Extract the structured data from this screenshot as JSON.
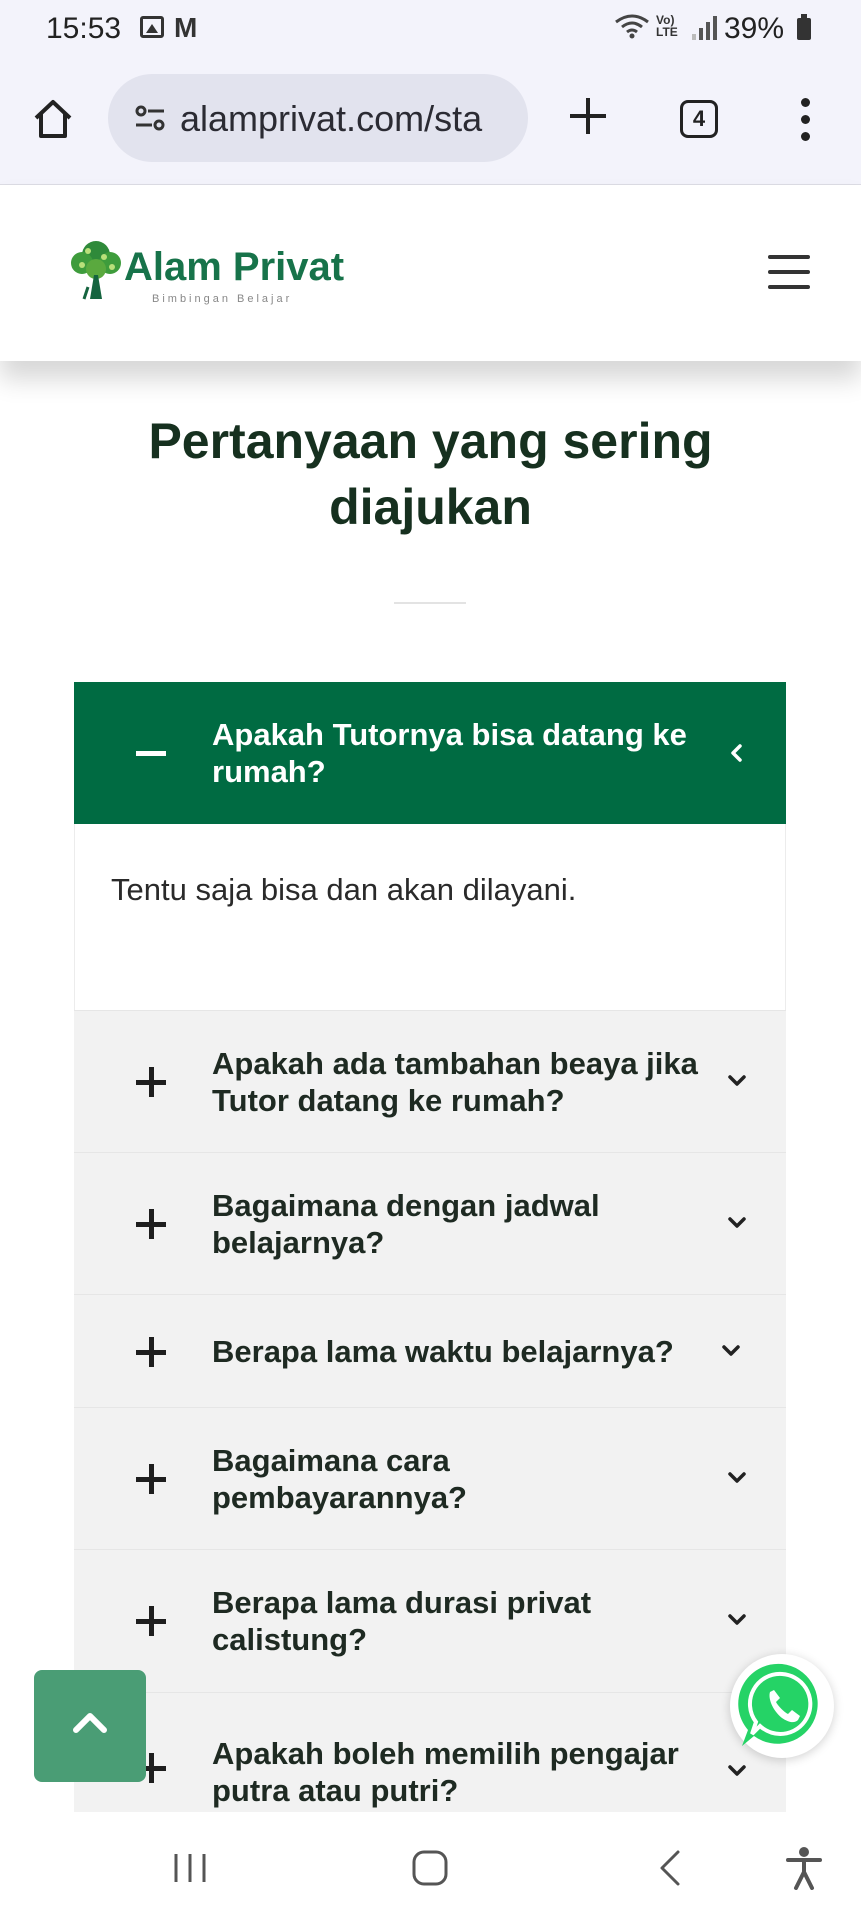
{
  "status_bar": {
    "time": "15:53",
    "mail_icon_glyph": "M",
    "lte_line1": "Vo)",
    "lte_line2": "LTE",
    "battery_percent": "39%"
  },
  "browser": {
    "url": "alamprivat.com/sta",
    "tab_count": "4"
  },
  "site": {
    "logo_text": "Alam Privat",
    "logo_tagline": "Bimbingan Belajar"
  },
  "faq": {
    "title": "Pertanyaan yang sering diajukan",
    "items": [
      {
        "question": "Apakah Tutornya bisa datang ke rumah?",
        "answer": "Tentu saja bisa dan akan dilayani.",
        "expanded": true
      },
      {
        "question": "Apakah ada tambahan beaya jika Tutor datang ke rumah?",
        "expanded": false
      },
      {
        "question": "Bagaimana dengan jadwal belajarnya?",
        "expanded": false
      },
      {
        "question": "Berapa lama waktu belajarnya?",
        "expanded": false
      },
      {
        "question": "Bagaimana cara pembayarannya?",
        "expanded": false
      },
      {
        "question": "Berapa lama durasi privat calistung?",
        "expanded": false
      },
      {
        "question": "Apakah boleh memilih pengajar putra atau putri?",
        "expanded": false
      }
    ]
  },
  "colors": {
    "brand_green": "#006b42",
    "logo_green": "#17734a",
    "scroll_top_green": "#4a9d75",
    "whatsapp_green": "#25d366"
  },
  "icons": [
    "home-icon",
    "tune-icon",
    "plus-icon",
    "menu-dots-icon",
    "hamburger-icon",
    "minus-icon",
    "plus-icon",
    "chevron-left-icon",
    "chevron-down-icon",
    "chevron-up-icon",
    "whatsapp-icon",
    "recent-apps-icon",
    "home-nav-icon",
    "back-icon",
    "accessibility-icon"
  ]
}
